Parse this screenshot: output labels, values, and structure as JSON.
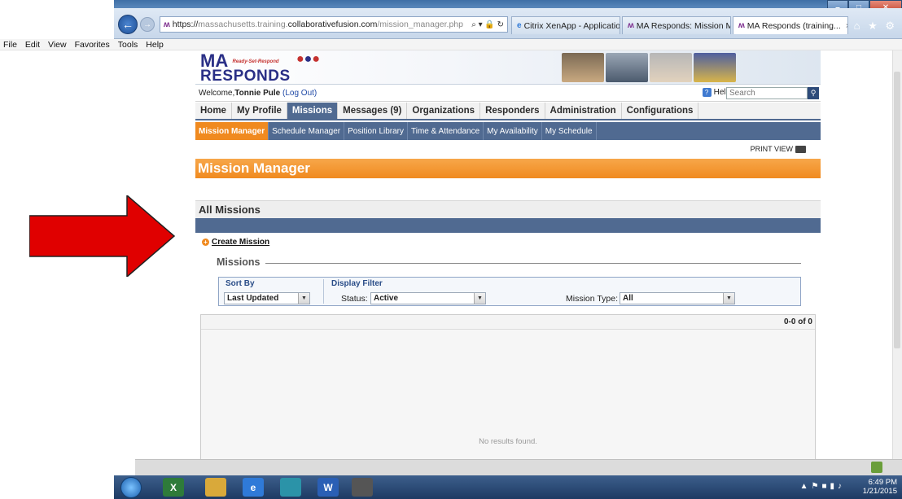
{
  "browser": {
    "address_scheme": "https://",
    "address_host_pre": "massachusetts.training.",
    "address_host_main": "collaborativefusion.com",
    "address_path": "/mission_manager.php",
    "address_tools": "⌕ ▾ 🔒 ↻",
    "tabs": [
      {
        "label": "Citrix XenApp - Applications"
      },
      {
        "label": "MA Responds: Mission Ma..."
      },
      {
        "label": "MA Responds (training..."
      }
    ],
    "tab_close": "×",
    "chrome_icons": "⌂ ★ ⚙"
  },
  "menubar": {
    "items": [
      "File",
      "Edit",
      "View",
      "Favorites",
      "Tools",
      "Help"
    ]
  },
  "header": {
    "logo_ma": "MA",
    "logo_tag": "Ready-Set-Respond",
    "logo_responds": "RESPONDS",
    "welcome_prefix": "Welcome, ",
    "user_name": "Tonnie Pule",
    "logout_label": "(Log Out)",
    "help_center": "Help Center",
    "search_placeholder": "Search"
  },
  "mainnav": [
    {
      "label": "Home"
    },
    {
      "label": "My Profile"
    },
    {
      "label": "Missions"
    },
    {
      "label": "Messages (9)"
    },
    {
      "label": "Organizations"
    },
    {
      "label": "Responders"
    },
    {
      "label": "Administration"
    },
    {
      "label": "Configurations"
    }
  ],
  "subnav": [
    {
      "label": "Mission Manager"
    },
    {
      "label": "Schedule Manager"
    },
    {
      "label": "Position Library"
    },
    {
      "label": "Time & Attendance"
    },
    {
      "label": "My Availability"
    },
    {
      "label": "My Schedule"
    }
  ],
  "page": {
    "print_view": "PRINT VIEW",
    "title": "Mission Manager",
    "section_title": "All Missions",
    "create_mission": "Create Mission",
    "missions_legend": "Missions"
  },
  "filters": {
    "sort_by_label": "Sort By",
    "sort_by_value": "Last Updated",
    "display_filter_label": "Display Filter",
    "status_label": "Status:",
    "status_value": "Active",
    "mission_type_label": "Mission Type:",
    "mission_type_value": "All"
  },
  "results": {
    "count": "0-0 of 0",
    "empty_text": "No results found."
  },
  "taskbar": {
    "time": "6:49 PM",
    "date": "1/21/2015"
  },
  "colors": {
    "accent_orange": "#f08a1f",
    "nav_blue": "#506a91",
    "arrow_red": "#e00000"
  }
}
